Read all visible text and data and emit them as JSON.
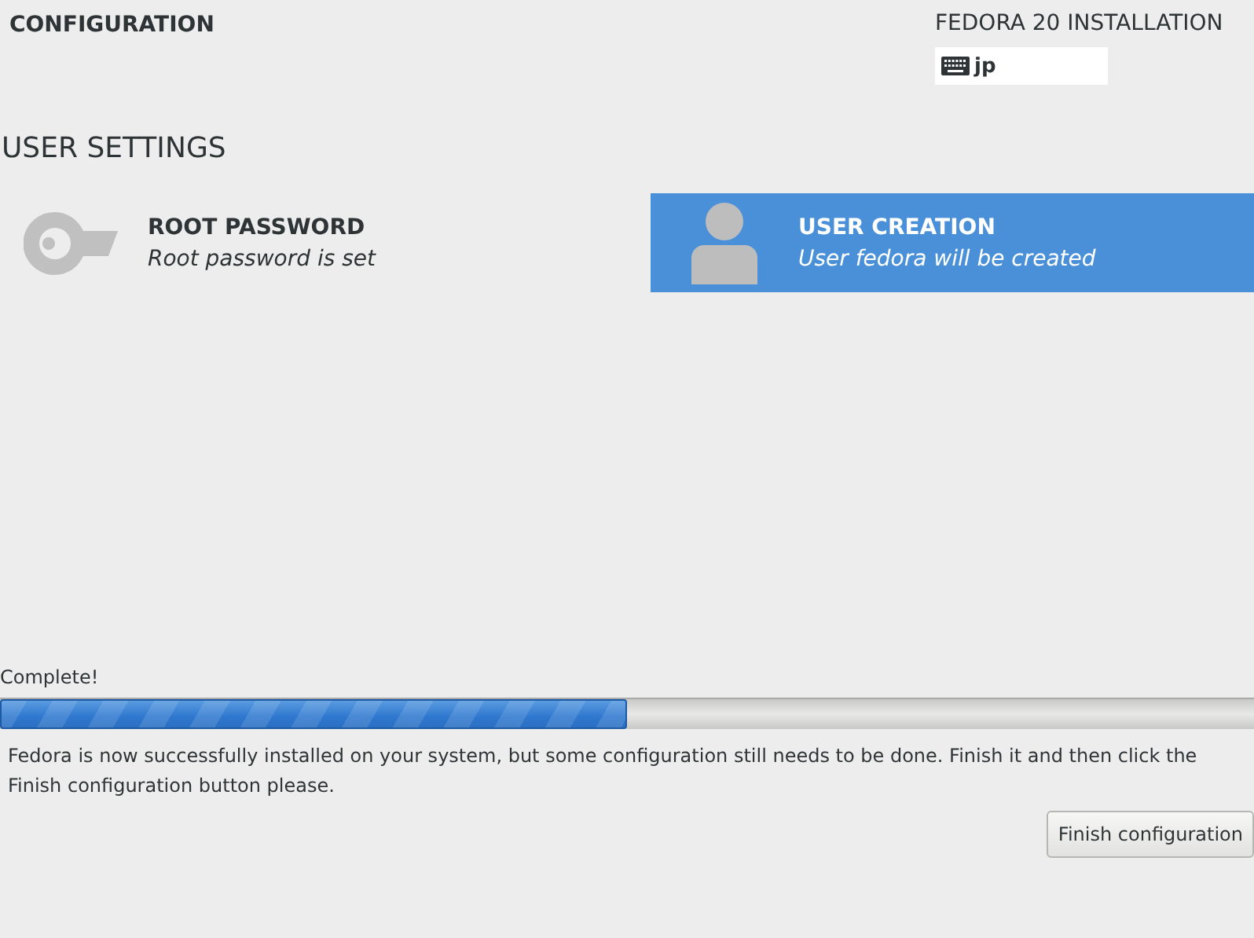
{
  "header": {
    "title": "CONFIGURATION",
    "product_title": "FEDORA 20 INSTALLATION",
    "keyboard_layout": "jp"
  },
  "section": {
    "title": "USER SETTINGS",
    "spokes": [
      {
        "kind": "password",
        "title": "ROOT PASSWORD",
        "status": "Root password is set",
        "selected": false
      },
      {
        "kind": "user",
        "title": "USER CREATION",
        "status": "User fedora will be created",
        "selected": true
      }
    ]
  },
  "progress": {
    "label": "Complete!",
    "level": 0.5
  },
  "message": "Fedora is now successfully installed on your system, but some configuration still needs to be done.  Finish it and then click the Finish configuration button please.",
  "buttons": [
    "Finish configuration"
  ]
}
